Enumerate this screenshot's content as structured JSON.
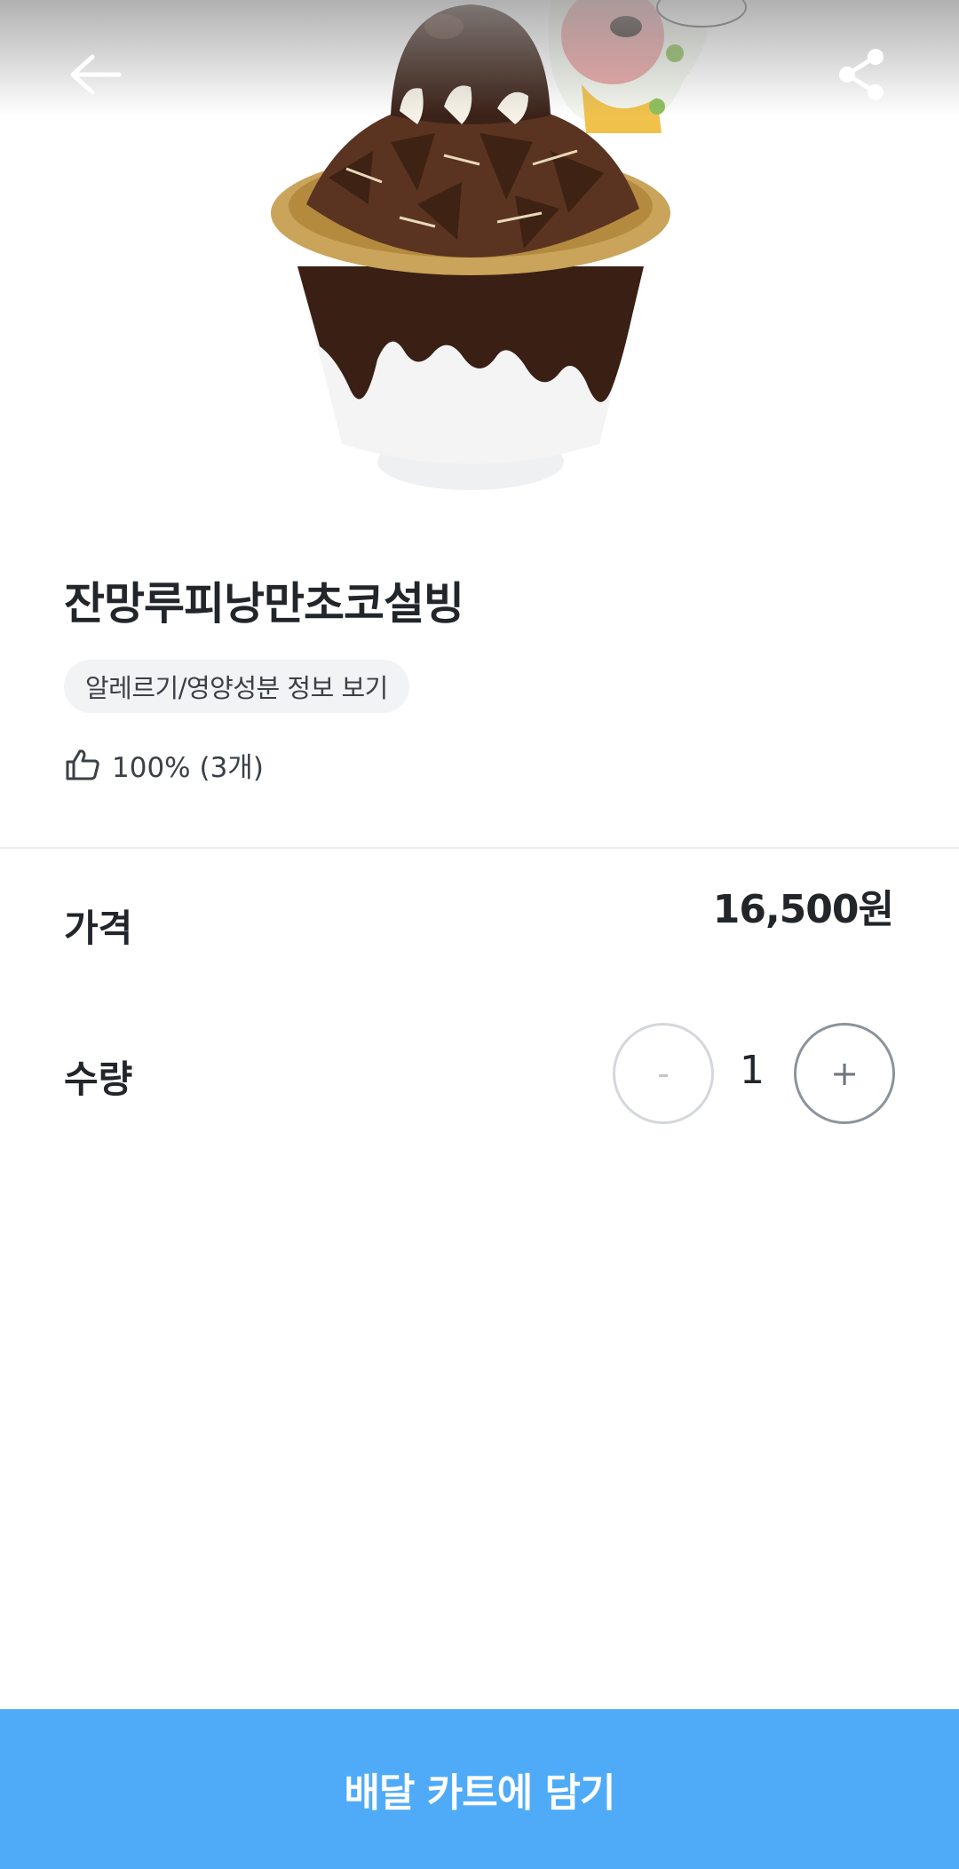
{
  "header": {
    "back_icon": "arrow-left-icon",
    "share_icon": "share-icon"
  },
  "product": {
    "name": "잔망루피낭만초코설빙",
    "info_chip": "알레르기/영양성분 정보 보기",
    "rating_icon": "thumbs-up-icon",
    "rating_text": "100% (3개)"
  },
  "price": {
    "label": "가격",
    "value": "16,500원"
  },
  "quantity": {
    "label": "수량",
    "value": "1",
    "minus_label": "-",
    "plus_label": "+"
  },
  "cart_button": {
    "label": "배달 카트에 담기"
  },
  "colors": {
    "accent": "#4fabf7",
    "text": "#22262b",
    "chip_bg": "#f2f3f5"
  }
}
